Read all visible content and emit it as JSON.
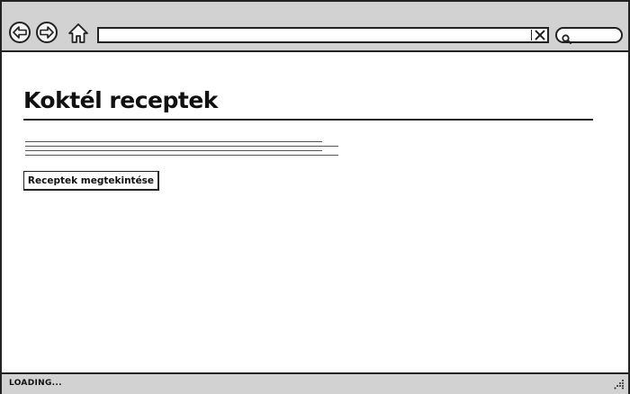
{
  "browser": {
    "address": {
      "value": "",
      "clear_glyph": "X"
    },
    "search": {
      "value": ""
    }
  },
  "page": {
    "title": "Koktél receptek",
    "view_button_label": "Receptek megtekintése"
  },
  "status": {
    "text": "LOADING..."
  },
  "icons": {
    "back": "arrow-left-icon",
    "forward": "arrow-right-icon",
    "home": "home-icon",
    "clear": "close-icon",
    "search": "search-icon",
    "grip": "resize-grip-icon"
  }
}
